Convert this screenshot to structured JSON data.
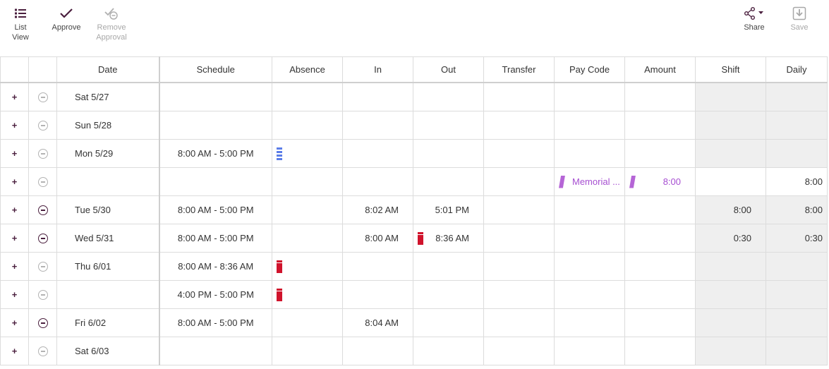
{
  "toolbar": {
    "list_view": "List View",
    "approve": "Approve",
    "remove_approval_1": "Remove",
    "remove_approval_2": "Approval",
    "share": "Share",
    "save": "Save"
  },
  "columns": {
    "date": "Date",
    "schedule": "Schedule",
    "absence": "Absence",
    "in": "In",
    "out": "Out",
    "transfer": "Transfer",
    "pay_code": "Pay Code",
    "amount": "Amount",
    "shift": "Shift",
    "daily": "Daily"
  },
  "rows": [
    {
      "date": "Sat 5/27",
      "schedule": "",
      "in": "",
      "out": "",
      "pay_code": "",
      "amount": "",
      "shift": "",
      "daily": ""
    },
    {
      "date": "Sun 5/28",
      "schedule": "",
      "in": "",
      "out": "",
      "pay_code": "",
      "amount": "",
      "shift": "",
      "daily": ""
    },
    {
      "date": "Mon 5/29",
      "schedule": "8:00 AM - 5:00 PM",
      "in": "",
      "out": "",
      "pay_code": "",
      "amount": "",
      "shift": "",
      "daily": ""
    },
    {
      "date": "",
      "schedule": "",
      "in": "",
      "out": "",
      "pay_code": "Memorial ...",
      "amount": "8:00",
      "shift": "",
      "daily": "8:00"
    },
    {
      "date": "Tue 5/30",
      "schedule": "8:00 AM - 5:00 PM",
      "in": "8:02 AM",
      "out": "5:01 PM",
      "pay_code": "",
      "amount": "",
      "shift": "8:00",
      "daily": "8:00"
    },
    {
      "date": "Wed 5/31",
      "schedule": "8:00 AM - 5:00 PM",
      "in": "8:00 AM",
      "out": "8:36 AM",
      "pay_code": "",
      "amount": "",
      "shift": "0:30",
      "daily": "0:30"
    },
    {
      "date": "Thu 6/01",
      "schedule": "8:00 AM - 8:36 AM",
      "in": "",
      "out": "",
      "pay_code": "",
      "amount": "",
      "shift": "",
      "daily": ""
    },
    {
      "date": "",
      "schedule": "4:00 PM - 5:00 PM",
      "in": "",
      "out": "",
      "pay_code": "",
      "amount": "",
      "shift": "",
      "daily": ""
    },
    {
      "date": "Fri 6/02",
      "schedule": "8:00 AM - 5:00 PM",
      "in": "8:04 AM",
      "out": "",
      "pay_code": "",
      "amount": "",
      "shift": "",
      "daily": ""
    },
    {
      "date": "Sat 6/03",
      "schedule": "",
      "in": "",
      "out": "",
      "pay_code": "",
      "amount": "",
      "shift": "",
      "daily": ""
    }
  ],
  "colors": {
    "accent": "#4a1f3e",
    "absence_blue": "#5b7de8",
    "exception_red": "#d0132c",
    "paycode_purple": "#a64ed1",
    "total_bg": "#efefef"
  },
  "icons": [
    "list-view-icon",
    "approve-check-icon",
    "remove-approval-icon",
    "share-icon",
    "save-icon",
    "add-row-plus-icon",
    "remove-row-minus-icon"
  ]
}
